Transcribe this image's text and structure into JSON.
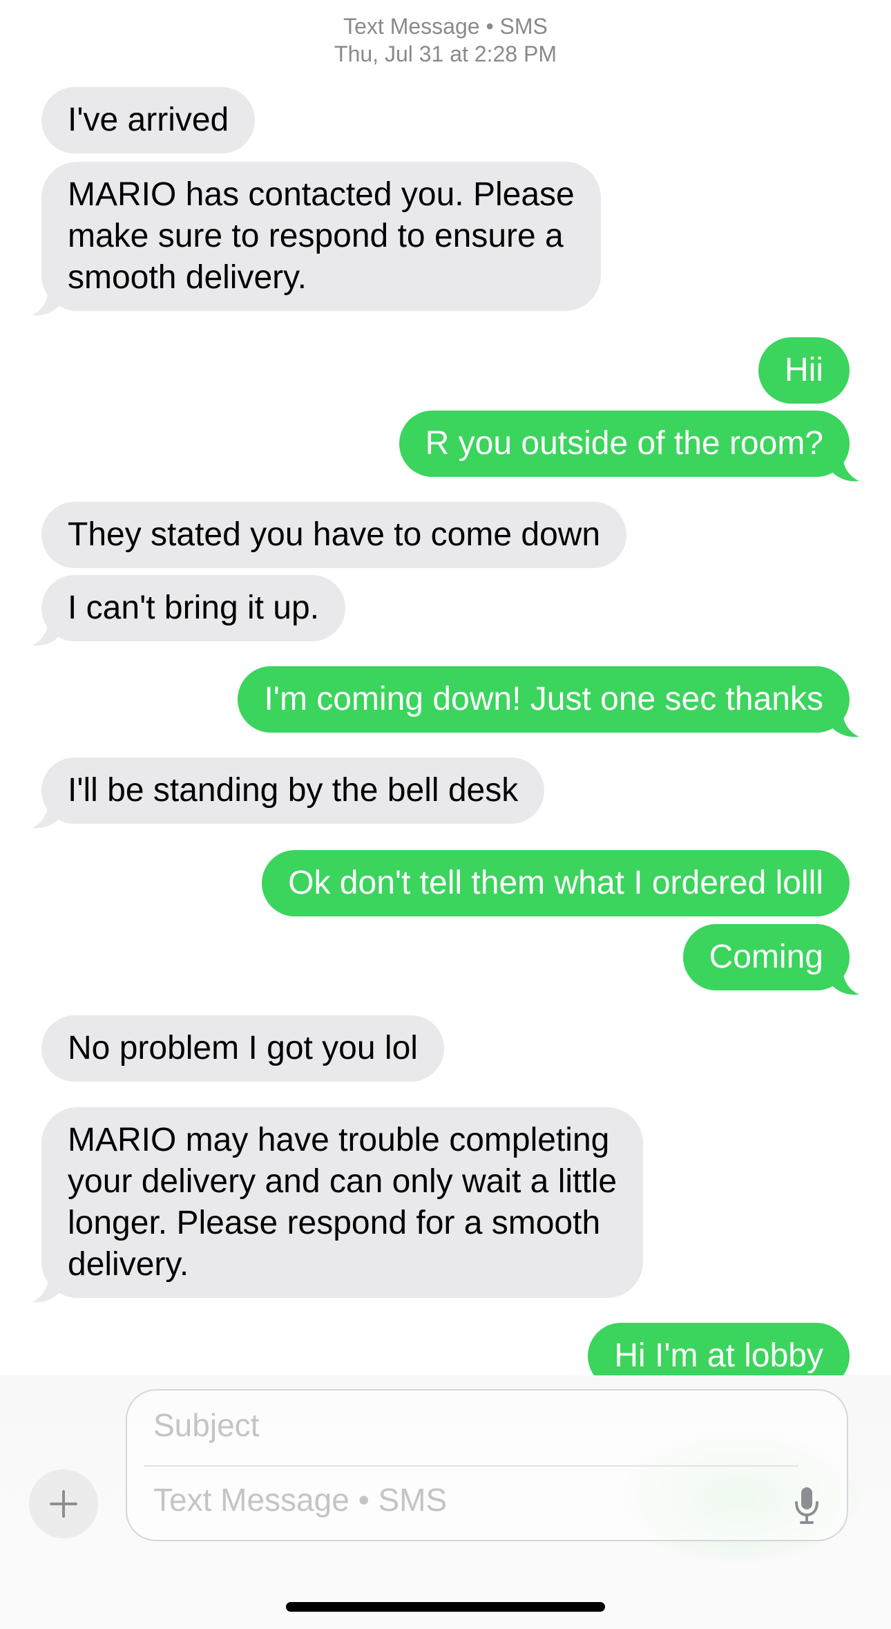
{
  "header": {
    "service": "Text Message • SMS",
    "timestamp": "Thu, Jul 31 at 2:28 PM"
  },
  "messages": [
    {
      "sender": "them",
      "text": "I've arrived"
    },
    {
      "sender": "them",
      "text": "MARIO has contacted you. Please\nmake sure to respond to ensure a\nsmooth delivery."
    },
    {
      "sender": "me",
      "text": "Hii"
    },
    {
      "sender": "me",
      "text": "R you outside of the room?"
    },
    {
      "sender": "them",
      "text": "They stated you have to come down"
    },
    {
      "sender": "them",
      "text": "I can't bring it up."
    },
    {
      "sender": "me",
      "text": "I'm coming down! Just one sec thanks"
    },
    {
      "sender": "them",
      "text": "I'll be standing by the bell desk"
    },
    {
      "sender": "me",
      "text": "Ok don't tell them what I ordered lolll"
    },
    {
      "sender": "me",
      "text": "Coming"
    },
    {
      "sender": "them",
      "text": "No problem I got you lol"
    },
    {
      "sender": "them",
      "text": "MARIO may have trouble completing\nyour delivery and can only wait a little\nlonger. Please respond for a smooth\ndelivery."
    },
    {
      "sender": "me",
      "text": "Hi I'm at lobby"
    }
  ],
  "composer": {
    "subject_placeholder": "Subject",
    "message_placeholder": "Text Message • SMS",
    "plus_icon": "plus-icon",
    "mic_icon": "microphone-icon"
  },
  "colors": {
    "incoming_bubble": "#e9e9eb",
    "outgoing_bubble": "#3bd45d",
    "header_text": "#8a8a8e"
  }
}
